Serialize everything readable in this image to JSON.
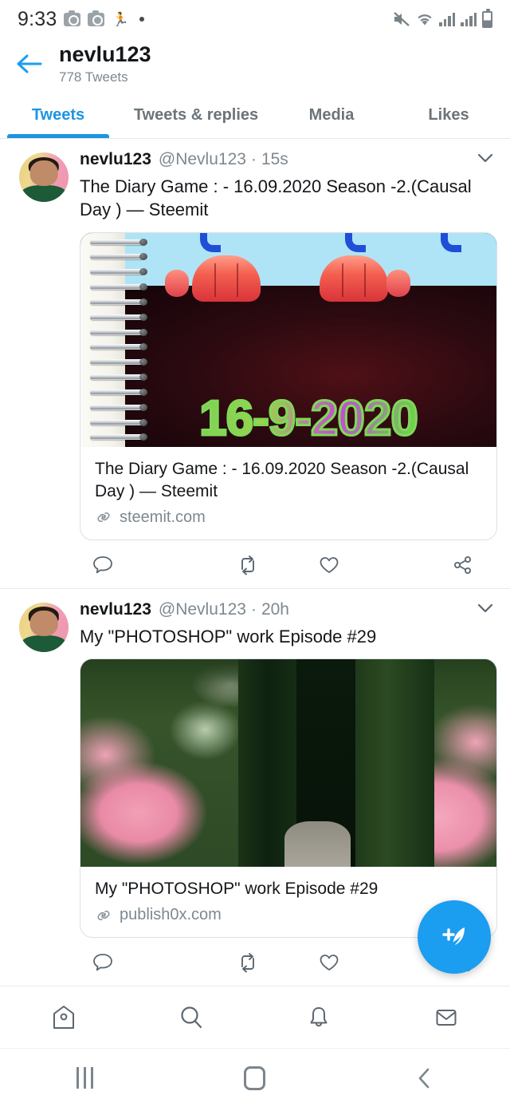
{
  "status_bar": {
    "time": "9:33",
    "left_icons": [
      "camera-icon",
      "camera-icon",
      "running-person-icon",
      "dot-icon"
    ],
    "right_icons": [
      "mute-icon",
      "wifi-icon",
      "signal-icon",
      "signal-icon",
      "battery-icon"
    ]
  },
  "header": {
    "back_icon": "back-arrow-icon",
    "title": "nevlu123",
    "subtitle": "778 Tweets"
  },
  "tabs": [
    {
      "label": "Tweets",
      "active": true
    },
    {
      "label": "Tweets & replies",
      "active": false
    },
    {
      "label": "Media",
      "active": false
    },
    {
      "label": "Likes",
      "active": false
    }
  ],
  "tweets": [
    {
      "display_name": "nevlu123",
      "handle": "@Nevlu123",
      "separator": "·",
      "timestamp": "15s",
      "text": "The Diary Game : - 16.09.2020 Season -2.(Causal Day ) — Steemit",
      "image_alt": "spiral-notebook-with-date",
      "image_text": "16-9-2020",
      "card_title": "The Diary Game : - 16.09.2020 Season -2.(Causal Day ) — Steemit",
      "card_domain": "steemit.com",
      "actions": [
        "reply-icon",
        "retweet-icon",
        "like-icon",
        "share-icon"
      ]
    },
    {
      "display_name": "nevlu123",
      "handle": "@Nevlu123",
      "separator": "·",
      "timestamp": "20h",
      "text": "My \"PHOTOSHOP\" work Episode #29",
      "image_alt": "garden-with-pink-roses-and-hedge",
      "card_title": "My \"PHOTOSHOP\" work Episode #29",
      "card_domain": "publish0x.com",
      "actions": [
        "reply-icon",
        "retweet-icon",
        "like-icon",
        "share-icon"
      ]
    }
  ],
  "compose_fab": {
    "icon": "compose-tweet-icon"
  },
  "bottom_nav": [
    {
      "icon": "home-icon",
      "label": "Home"
    },
    {
      "icon": "search-icon",
      "label": "Search"
    },
    {
      "icon": "notifications-bell-icon",
      "label": "Notifications"
    },
    {
      "icon": "messages-envelope-icon",
      "label": "Messages"
    }
  ],
  "android_nav": [
    {
      "icon": "recents-icon"
    },
    {
      "icon": "home-square-icon"
    },
    {
      "icon": "back-chevron-icon"
    }
  ],
  "colors": {
    "accent": "#1b95e0",
    "fab": "#1b9df0",
    "text_primary": "#14171a",
    "text_secondary": "#7d8890",
    "border": "#e6eaed"
  }
}
